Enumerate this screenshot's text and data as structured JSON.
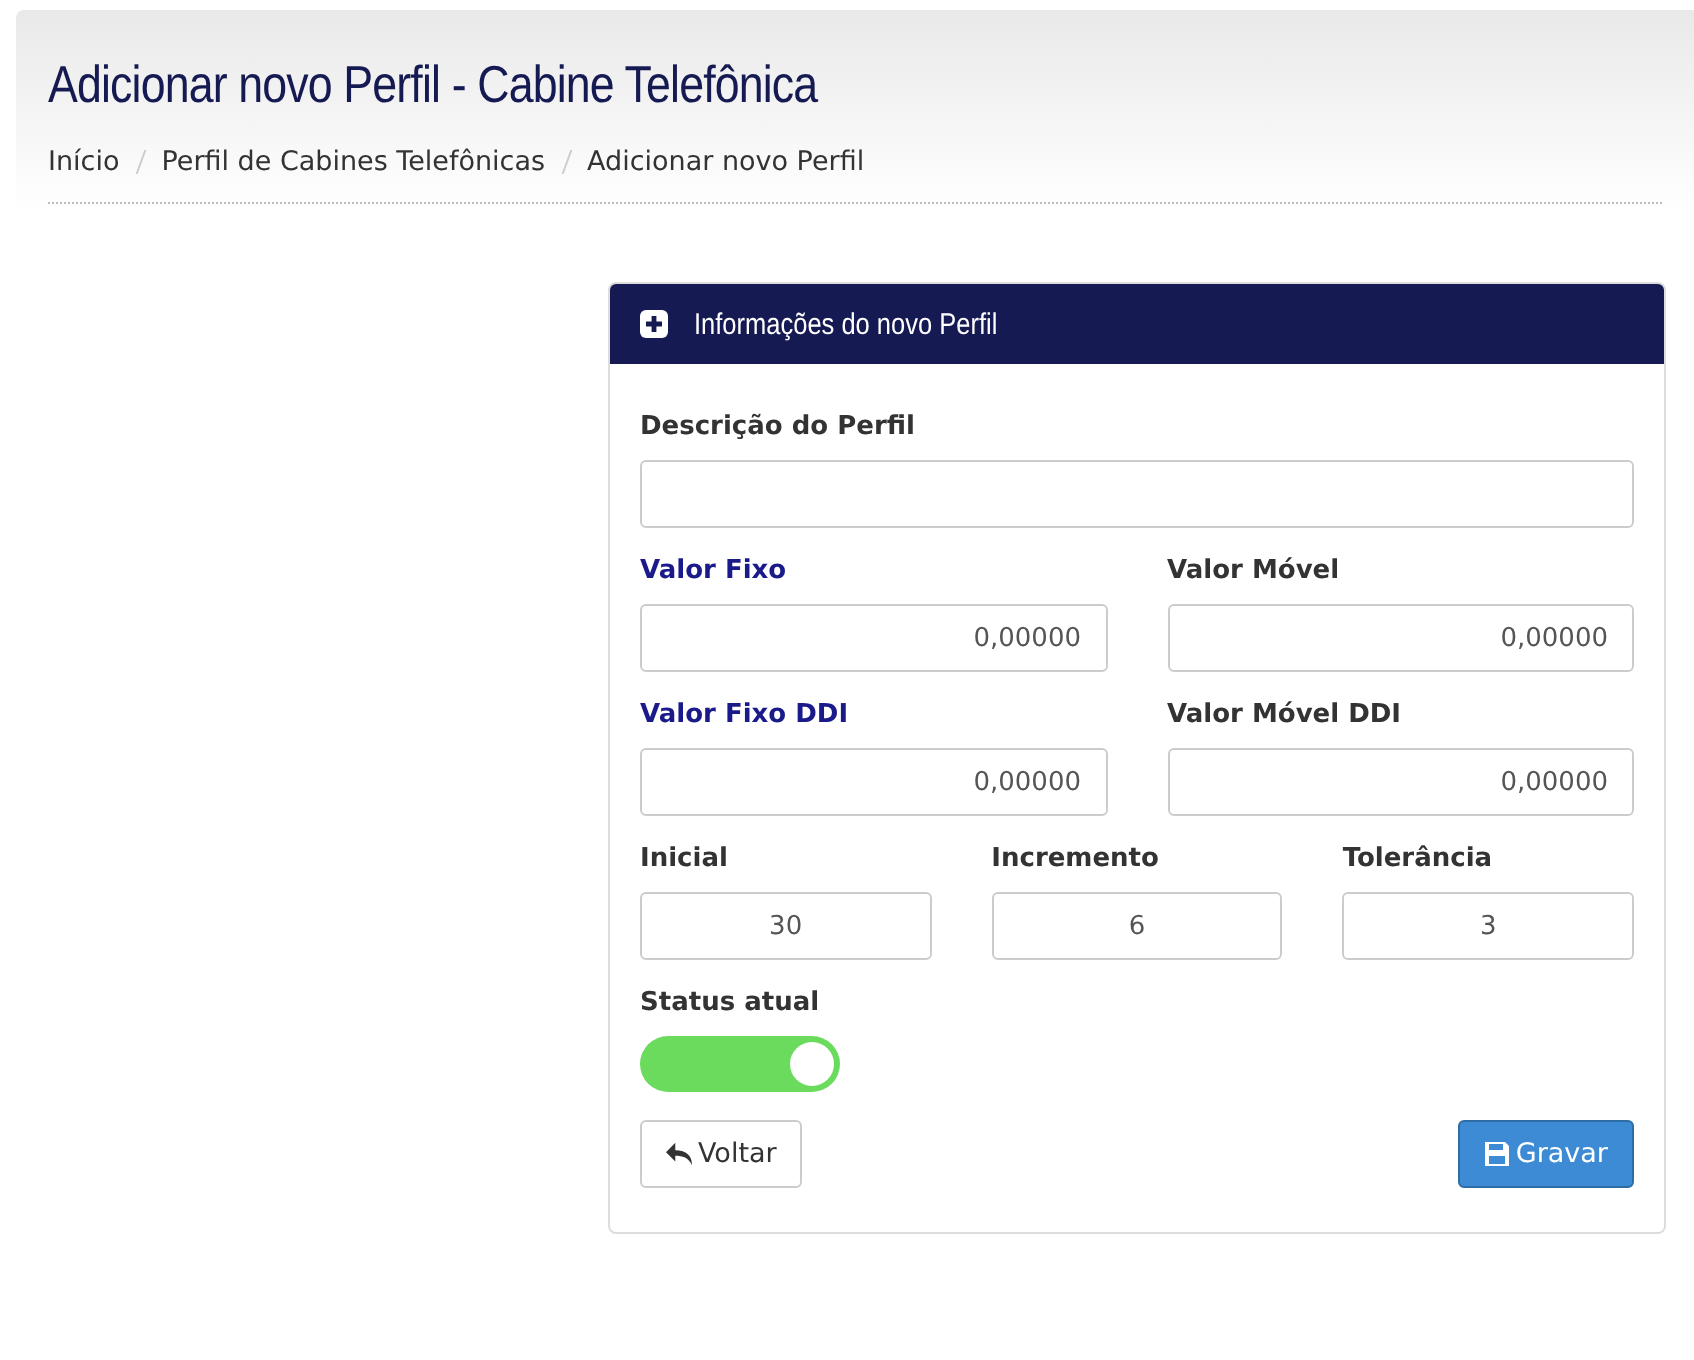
{
  "page_title": "Adicionar novo Perfil - Cabine Telefônica",
  "breadcrumb": [
    "Início",
    "Perfil de Cabines Telefônicas",
    "Adicionar novo Perfil"
  ],
  "panel": {
    "title": "Informações do novo Perfil",
    "rows": [
      {
        "fields": [
          {
            "label": "Descrição do Perfil",
            "highlighted": false,
            "kind": "text"
          }
        ]
      },
      {
        "fields": [
          {
            "label": "Valor Fixo",
            "highlighted": true,
            "value": "0,00000",
            "kind": "decimal"
          },
          {
            "label": "Valor Móvel",
            "highlighted": false,
            "value": "0,00000",
            "kind": "decimal"
          }
        ]
      },
      {
        "fields": [
          {
            "label": "Valor Fixo DDI",
            "highlighted": true,
            "value": "0,00000",
            "kind": "decimal"
          },
          {
            "label": "Valor Móvel DDI",
            "highlighted": false,
            "value": "0,00000",
            "kind": "decimal"
          }
        ]
      },
      {
        "fields": [
          {
            "label": "Inicial",
            "highlighted": false,
            "value": "30",
            "kind": "integer"
          },
          {
            "label": "Incremento",
            "highlighted": false,
            "value": "6",
            "kind": "integer"
          },
          {
            "label": "Tolerância",
            "highlighted": false,
            "value": "3",
            "kind": "integer"
          }
        ]
      }
    ],
    "status": {
      "label": "Status atual",
      "on": true
    },
    "buttons": [
      {
        "label": "Voltar",
        "kind": "back"
      },
      {
        "label": "Gravar",
        "kind": "save"
      }
    ]
  }
}
